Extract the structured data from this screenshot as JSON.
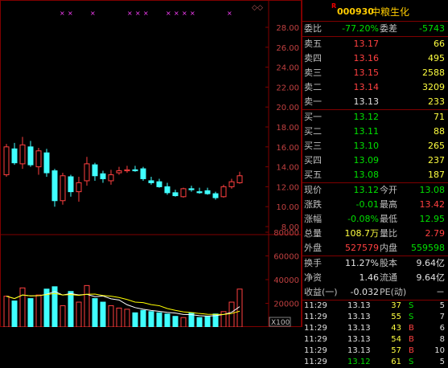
{
  "stock": {
    "flag": "R",
    "code": "000930",
    "name": "中粮生化"
  },
  "axis": {
    "price_ticks": [
      "28.00",
      "26.00",
      "24.00",
      "22.00",
      "20.00",
      "18.00",
      "16.00",
      "14.00",
      "12.00",
      "10.00",
      "8.00"
    ],
    "volume_ticks": [
      "80000",
      "60000",
      "40000",
      "20000"
    ],
    "volume_unit": "X100"
  },
  "quote": {
    "webi_label": "委比",
    "webi": "-77.20%",
    "weicha_label": "委差",
    "weicha": "-5743",
    "sell": [
      {
        "label": "卖五",
        "price": "13.17",
        "vol": "66"
      },
      {
        "label": "卖四",
        "price": "13.16",
        "vol": "495"
      },
      {
        "label": "卖三",
        "price": "13.15",
        "vol": "2588"
      },
      {
        "label": "卖二",
        "price": "13.14",
        "vol": "3209"
      },
      {
        "label": "卖一",
        "price": "13.13",
        "vol": "233"
      }
    ],
    "buy": [
      {
        "label": "买一",
        "price": "13.12",
        "vol": "71"
      },
      {
        "label": "买二",
        "price": "13.11",
        "vol": "88"
      },
      {
        "label": "买三",
        "price": "13.10",
        "vol": "265"
      },
      {
        "label": "买四",
        "price": "13.09",
        "vol": "237"
      },
      {
        "label": "买五",
        "price": "13.08",
        "vol": "187"
      }
    ],
    "stats": [
      {
        "l1": "现价",
        "v1": "13.12",
        "c1": "grn",
        "l2": "今开",
        "v2": "13.08",
        "c2": "grn"
      },
      {
        "l1": "涨跌",
        "v1": "-0.01",
        "c1": "grn",
        "l2": "最高",
        "v2": "13.42",
        "c2": "red"
      },
      {
        "l1": "涨幅",
        "v1": "-0.08%",
        "c1": "grn",
        "l2": "最低",
        "v2": "12.95",
        "c2": "grn"
      },
      {
        "l1": "总量",
        "v1": "108.7万",
        "c1": "yel",
        "l2": "量比",
        "v2": "2.79",
        "c2": "red"
      },
      {
        "l1": "外盘",
        "v1": "527579",
        "c1": "red",
        "l2": "内盘",
        "v2": "559598",
        "c2": "grn"
      }
    ],
    "extra": [
      {
        "l1": "换手",
        "v1": "11.27%",
        "l2": "股本",
        "v2": "9.64亿"
      },
      {
        "l1": "净资",
        "v1": "1.46",
        "l2": "流通",
        "v2": "9.64亿"
      },
      {
        "l1": "收益(一)",
        "v1": "-0.032",
        "l2": "PE(动)",
        "v2": "－"
      }
    ]
  },
  "ticks": [
    {
      "time": "11:29",
      "price": "13.13",
      "vol": "37",
      "bs": "S",
      "n": "5"
    },
    {
      "time": "11:29",
      "price": "13.13",
      "vol": "55",
      "bs": "S",
      "n": "7"
    },
    {
      "time": "11:29",
      "price": "13.13",
      "vol": "43",
      "bs": "B",
      "n": "6"
    },
    {
      "time": "11:29",
      "price": "13.13",
      "vol": "54",
      "bs": "B",
      "n": "8"
    },
    {
      "time": "11:29",
      "price": "13.13",
      "vol": "57",
      "bs": "B",
      "n": "10"
    },
    {
      "time": "11:29",
      "price": "13.12",
      "vol": "61",
      "bs": "S",
      "n": "5"
    }
  ],
  "candles": [
    {
      "o": 13.2,
      "h": 16.3,
      "l": 13.0,
      "c": 16.0
    },
    {
      "o": 15.8,
      "h": 16.4,
      "l": 14.2,
      "c": 14.4
    },
    {
      "o": 14.3,
      "h": 17.0,
      "l": 13.8,
      "c": 16.2
    },
    {
      "o": 16.0,
      "h": 16.6,
      "l": 14.0,
      "c": 14.2
    },
    {
      "o": 14.0,
      "h": 15.9,
      "l": 13.2,
      "c": 15.6
    },
    {
      "o": 15.4,
      "h": 15.8,
      "l": 13.0,
      "c": 13.4
    },
    {
      "o": 13.6,
      "h": 13.8,
      "l": 10.0,
      "c": 10.6
    },
    {
      "o": 10.6,
      "h": 13.4,
      "l": 10.2,
      "c": 13.1
    },
    {
      "o": 13.0,
      "h": 13.2,
      "l": 11.0,
      "c": 11.5
    },
    {
      "o": 11.5,
      "h": 13.0,
      "l": 10.5,
      "c": 12.4
    },
    {
      "o": 12.6,
      "h": 15.0,
      "l": 12.1,
      "c": 14.3
    },
    {
      "o": 14.2,
      "h": 14.4,
      "l": 12.6,
      "c": 13.1
    },
    {
      "o": 13.3,
      "h": 13.6,
      "l": 12.4,
      "c": 12.8
    },
    {
      "o": 12.6,
      "h": 13.7,
      "l": 12.2,
      "c": 13.2
    },
    {
      "o": 13.4,
      "h": 14.0,
      "l": 13.2,
      "c": 13.6
    },
    {
      "o": 13.6,
      "h": 14.1,
      "l": 13.4,
      "c": 13.7
    },
    {
      "o": 13.7,
      "h": 14.1,
      "l": 13.5,
      "c": 13.6
    },
    {
      "o": 13.8,
      "h": 14.0,
      "l": 12.6,
      "c": 12.8
    },
    {
      "o": 12.6,
      "h": 13.0,
      "l": 12.2,
      "c": 12.4
    },
    {
      "o": 12.5,
      "h": 12.8,
      "l": 11.9,
      "c": 12.0
    },
    {
      "o": 12.0,
      "h": 12.4,
      "l": 11.2,
      "c": 11.4
    },
    {
      "o": 11.4,
      "h": 11.7,
      "l": 11.0,
      "c": 11.1
    },
    {
      "o": 11.0,
      "h": 11.9,
      "l": 10.9,
      "c": 11.8
    },
    {
      "o": 11.8,
      "h": 12.1,
      "l": 11.5,
      "c": 11.7
    },
    {
      "o": 11.5,
      "h": 11.9,
      "l": 11.3,
      "c": 11.4
    },
    {
      "o": 11.6,
      "h": 11.9,
      "l": 11.2,
      "c": 11.3
    },
    {
      "o": 11.3,
      "h": 11.5,
      "l": 10.7,
      "c": 10.9
    },
    {
      "o": 11.0,
      "h": 12.2,
      "l": 10.9,
      "c": 12.0
    },
    {
      "o": 12.0,
      "h": 12.8,
      "l": 11.8,
      "c": 12.5
    },
    {
      "o": 12.4,
      "h": 13.5,
      "l": 12.3,
      "c": 13.1
    }
  ],
  "volumes": [
    26000,
    22000,
    33000,
    24000,
    27000,
    32000,
    34000,
    18000,
    30000,
    21000,
    35000,
    24000,
    21000,
    18000,
    16000,
    15000,
    12000,
    14000,
    13000,
    12000,
    11000,
    9000,
    8000,
    12000,
    8000,
    9000,
    11000,
    13000,
    21000,
    32000
  ]
}
